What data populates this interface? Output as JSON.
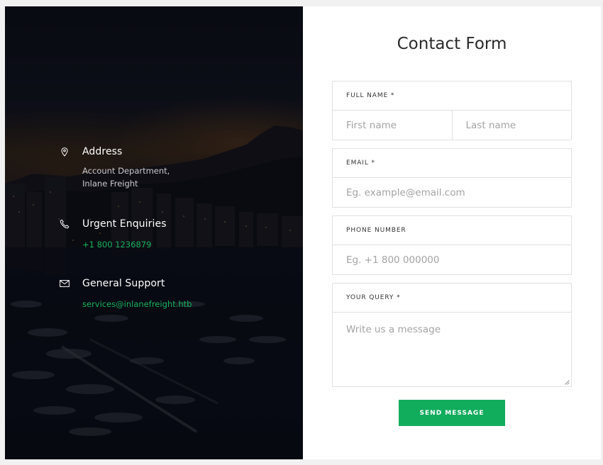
{
  "contact": {
    "address_title": "Address",
    "address_text": "Account Department,\nInlane Freight",
    "urgent_title": "Urgent Enquiries",
    "urgent_phone": "+1 800 1236879",
    "support_title": "General Support",
    "support_email": "services@inlanefreight.htb",
    "icons": {
      "address": "map-pin-icon",
      "urgent": "phone-icon",
      "support": "mail-icon"
    }
  },
  "form": {
    "title": "Contact Form",
    "full_name_label": "FULL NAME *",
    "first_name_placeholder": "First name",
    "last_name_placeholder": "Last name",
    "email_label": "EMAIL *",
    "email_placeholder": "Eg. example@email.com",
    "phone_label": "PHONE NUMBER",
    "phone_placeholder": "Eg. +1 800 000000",
    "query_label": "YOUR QUERY *",
    "query_placeholder": "Write us a message",
    "send_label": "SEND MESSAGE"
  },
  "colors": {
    "accent": "#12ac5d",
    "link_green": "#16b25d",
    "panel_dark": "#0d0f1a"
  }
}
